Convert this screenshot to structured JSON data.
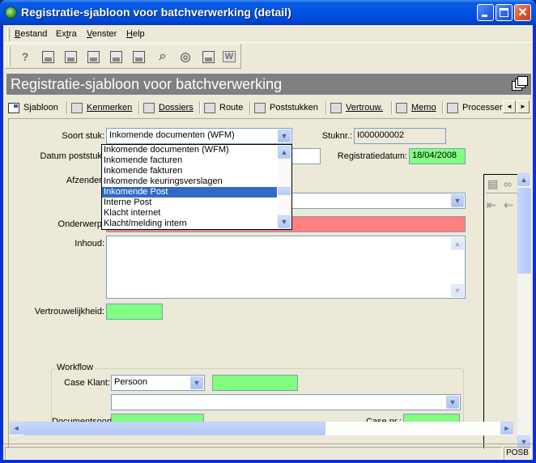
{
  "window": {
    "title": "Registratie-sjabloon voor batchverwerking (detail)",
    "controls": {
      "minimize": "_",
      "maximize": "□",
      "close": "✕"
    }
  },
  "menubar": {
    "items": [
      {
        "label": "Bestand",
        "accel": "B"
      },
      {
        "label": "Extra",
        "accel": "t"
      },
      {
        "label": "Venster",
        "accel": "V"
      },
      {
        "label": "Help",
        "accel": "H"
      }
    ]
  },
  "toolbar": {
    "buttons": [
      {
        "icon": "help-icon",
        "glyph": "?"
      },
      {
        "icon": "save-icon"
      },
      {
        "icon": "save-close-icon"
      },
      {
        "icon": "edit-template-icon"
      },
      {
        "icon": "tree-icon"
      },
      {
        "icon": "copy-icon"
      },
      {
        "icon": "search-icon"
      },
      {
        "icon": "target-search-icon"
      },
      {
        "icon": "export-icon"
      },
      {
        "icon": "word-icon",
        "glyph": "W"
      }
    ]
  },
  "header": {
    "title": "Registratie-sjabloon voor batchverwerking"
  },
  "tabs": [
    {
      "label": "Sjabloon",
      "active": true
    },
    {
      "label": "Kenmerken"
    },
    {
      "label": "Dossiers"
    },
    {
      "label": "Route"
    },
    {
      "label": "Poststukken"
    },
    {
      "label": "Vertrouw."
    },
    {
      "label": "Memo"
    },
    {
      "label": "Processen"
    }
  ],
  "tab_scroll": {
    "left": "◄",
    "right": "►"
  },
  "form": {
    "soort_stuk": {
      "label": "Soort stuk:",
      "value": "Inkomende documenten (WFM)"
    },
    "stuknr": {
      "label": "Stuknr.:",
      "value": "I000000002"
    },
    "datum_poststuk": {
      "label": "Datum poststuk:",
      "value": ""
    },
    "registratiedatum": {
      "label": "Registratiedatum:",
      "value": "18/04/2008"
    },
    "afzender": {
      "label": "Afzender:",
      "value": ""
    },
    "onderwerp": {
      "label": "Onderwerp:",
      "value": ""
    },
    "inhoud": {
      "label": "Inhoud:",
      "value": ""
    },
    "vertrouwelijkheid": {
      "label": "Vertrouwelijkheid:",
      "value": ""
    }
  },
  "dropdown": {
    "options": [
      "Inkomende documenten (WFM)",
      "Inkomende facturen",
      "Inkomende fakturen",
      "Inkomende keuringsverslagen",
      "Inkomende Post",
      "Interne Post",
      "Klacht internet",
      "Klacht/melding intern"
    ],
    "highlighted": "Inkomende Post"
  },
  "workflow": {
    "title": "Workflow",
    "case_klant": {
      "label": "Case Klant:",
      "value": "Persoon"
    },
    "case_klant_extra": "",
    "case_select": "",
    "documentsoort": {
      "label": "Documentsoort:",
      "value": ""
    },
    "case_nr": {
      "label": "Case nr.:",
      "value": ""
    }
  },
  "statusbar": {
    "message": "",
    "mode": "POSB"
  },
  "colors": {
    "required": "#ff8080",
    "readonly_green": "#80ff80",
    "selection": "#316ac5",
    "header_band": "#808080"
  }
}
